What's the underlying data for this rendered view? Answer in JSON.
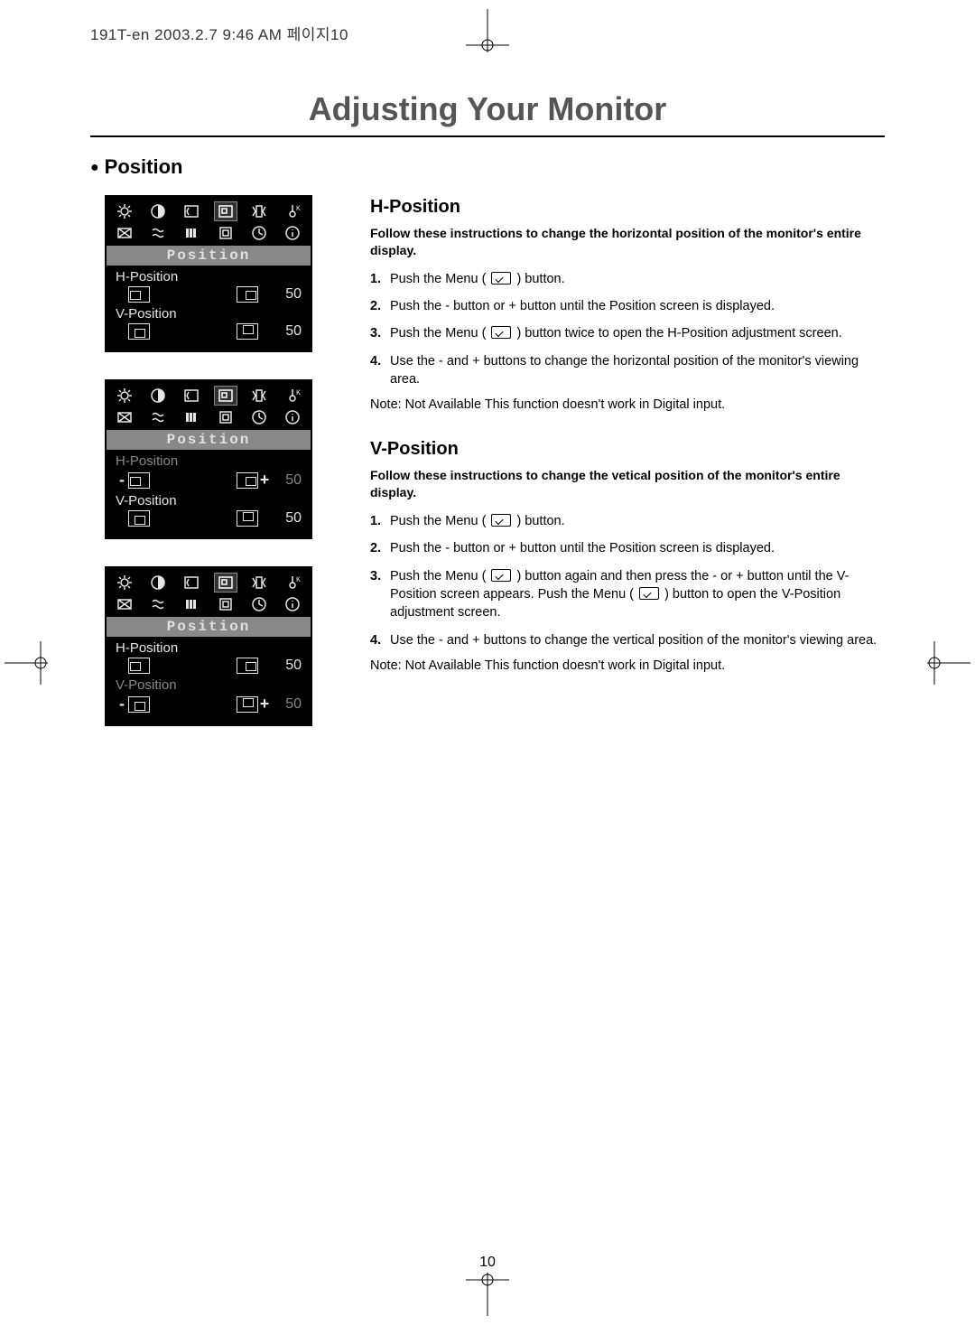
{
  "header_line": "191T-en  2003.2.7 9:46 AM  페이지10",
  "title": "Adjusting Your Monitor",
  "bullet_heading": "Position",
  "osd_label": "Position",
  "panels": [
    {
      "h_label": "H-Position",
      "h_dim": false,
      "h_left_icon": "inner-left",
      "h_right_icon": "inner-right",
      "h_minus": "",
      "h_plus": "",
      "h_val": "50",
      "h_val_dim": false,
      "v_label": "V-Position",
      "v_dim": false,
      "v_left_icon": "inner-bottom",
      "v_right_icon": "inner-top",
      "v_minus": "",
      "v_plus": "",
      "v_val": "50",
      "v_val_dim": false
    },
    {
      "h_label": "H-Position",
      "h_dim": true,
      "h_left_icon": "inner-left",
      "h_right_icon": "inner-right",
      "h_minus": "-",
      "h_plus": "+",
      "h_val": "50",
      "h_val_dim": true,
      "v_label": "V-Position",
      "v_dim": false,
      "v_left_icon": "inner-bottom",
      "v_right_icon": "inner-top",
      "v_minus": "",
      "v_plus": "",
      "v_val": "50",
      "v_val_dim": false
    },
    {
      "h_label": "H-Position",
      "h_dim": false,
      "h_left_icon": "inner-left",
      "h_right_icon": "inner-right",
      "h_minus": "",
      "h_plus": "",
      "h_val": "50",
      "h_val_dim": false,
      "v_label": "V-Position",
      "v_dim": true,
      "v_left_icon": "inner-bottom",
      "v_right_icon": "inner-top",
      "v_minus": "-",
      "v_plus": "+",
      "v_val": "50",
      "v_val_dim": true
    }
  ],
  "sections": {
    "h": {
      "heading": "H-Position",
      "intro": "Follow these instructions to change the horizontal position of the monitor's entire display.",
      "steps": [
        "Push the Menu ( ▢ ) button.",
        "Push the - button or + button until the Position screen is displayed.",
        "Push the Menu ( ▢ ) button twice to open the H-Position adjustment screen.",
        "Use the - and + buttons to change the horizontal position of the monitor's viewing area."
      ],
      "note": "Note: Not Available This function doesn't work in Digital input."
    },
    "v": {
      "heading": "V-Position",
      "intro": "Follow these instructions to change the vetical position of the monitor's entire display.",
      "steps": [
        "Push the Menu ( ▢ ) button.",
        "Push the - button or + button until the Position screen is displayed.",
        "Push the Menu ( ▢ ) button again and then press the - or + button until the V-Position screen appears. Push the Menu ( ▢ ) button to open the V-Position adjustment screen.",
        "Use the - and + buttons to change the vertical position of the monitor's viewing area."
      ],
      "note": "Note: Not Available This function doesn't work in Digital input."
    }
  },
  "page_number": "10"
}
